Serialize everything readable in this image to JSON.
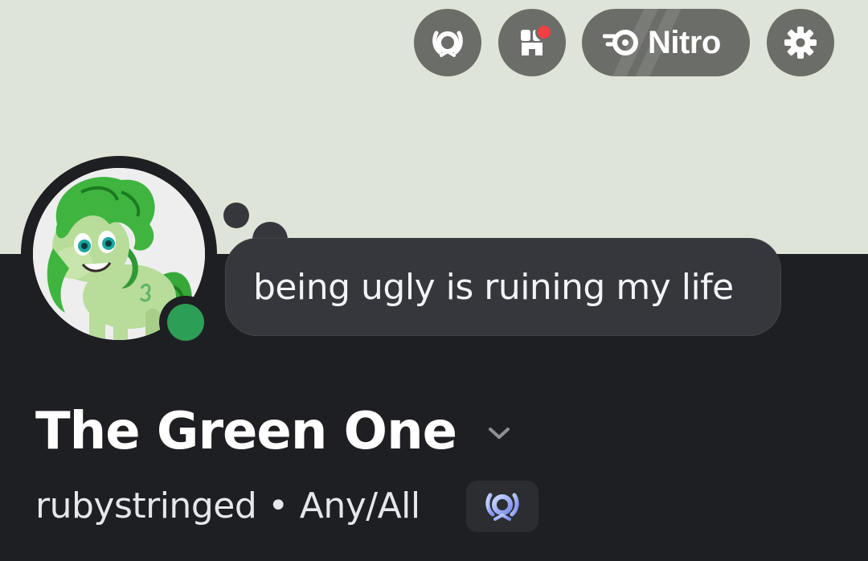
{
  "header": {
    "buttons": [
      {
        "name": "quests",
        "icon": "quests-laurel-icon"
      },
      {
        "name": "shop",
        "icon": "shop-icon",
        "notification_dot": true
      },
      {
        "name": "nitro",
        "icon": "nitro-icon",
        "label": "Nitro"
      },
      {
        "name": "settings",
        "icon": "gear-icon"
      }
    ]
  },
  "profile": {
    "display_name": "The Green One",
    "custom_status": "being ugly is ruining my life",
    "username": "rubystringed",
    "separator": "•",
    "pronouns": "Any/All",
    "online_status": "online",
    "badge_icon": "quest-badge-icon"
  },
  "colors": {
    "banner": "#dee5d8",
    "background": "#1e1f23",
    "online": "#2d9e55",
    "notification": "#f23f43",
    "bubble": "#36373d"
  }
}
